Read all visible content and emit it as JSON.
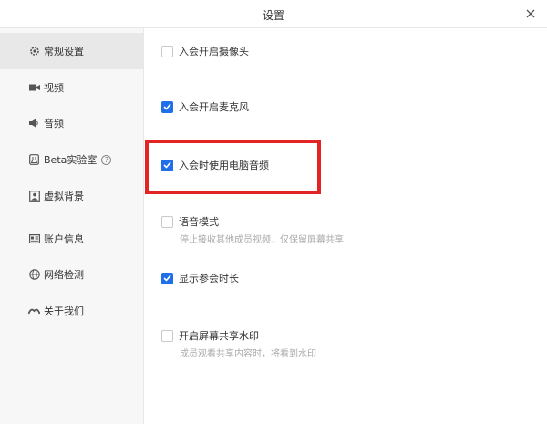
{
  "window": {
    "title": "设置"
  },
  "sidebar": {
    "items": [
      {
        "label": "常规设置",
        "icon": "gear-icon",
        "active": true
      },
      {
        "label": "视频",
        "icon": "video-camera-icon"
      },
      {
        "label": "音频",
        "icon": "speaker-icon"
      },
      {
        "label": "Beta实验室",
        "icon": "beaker-icon",
        "help": "?"
      },
      {
        "label": "虚拟背景",
        "icon": "person-background-icon"
      },
      {
        "label": "账户信息",
        "icon": "id-card-icon"
      },
      {
        "label": "网络检测",
        "icon": "globe-icon"
      },
      {
        "label": "关于我们",
        "icon": "logo-icon"
      }
    ]
  },
  "settings": {
    "options": [
      {
        "label": "入会开启摄像头",
        "checked": false
      },
      {
        "label": "入会开启麦克风",
        "checked": true
      },
      {
        "label": "入会时使用电脑音频",
        "checked": true
      },
      {
        "label": "语音模式",
        "checked": false,
        "description": "停止接收其他成员视频，仅保留屏幕共享"
      },
      {
        "label": "显示参会时长",
        "checked": true
      },
      {
        "label": "开启屏幕共享水印",
        "checked": false,
        "description": "成员观看共享内容时，将看到水印"
      }
    ]
  },
  "colors": {
    "accent": "#1f6fe8",
    "annotation": "#e22424",
    "sidebar_bg": "#f7f7f7"
  }
}
